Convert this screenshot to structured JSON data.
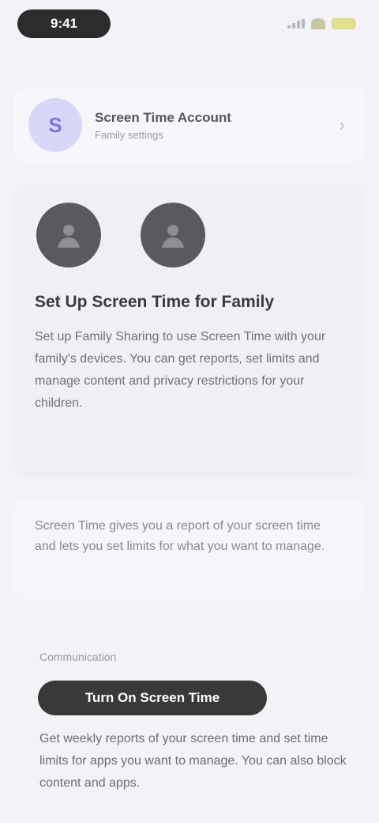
{
  "status_bar": {
    "time": "9:41",
    "signal_icon": "signal-icon",
    "wifi_icon": "wifi-icon",
    "battery_icon": "battery-icon"
  },
  "account": {
    "avatar_initials": "S",
    "name": "Screen Time Account",
    "subtitle": "Family settings",
    "chevron_icon": "chevron-right-icon"
  },
  "main_card": {
    "icon_left": "person-icon",
    "icon_right": "person-icon",
    "title": "Set Up Screen Time for Family",
    "description": "Set up Family Sharing to use Screen Time with your family's devices. You can get reports, set limits and manage content and privacy restrictions for your children."
  },
  "info_card": {
    "text": "Screen Time gives you a report of your screen time and lets you set limits for what you want to manage."
  },
  "bottom": {
    "section_label": "Communication",
    "button_label": "Turn On Screen Time",
    "aside_text": "",
    "description": "Get weekly reports of your screen time and set time limits for apps you want to manage. You can also block content and apps."
  },
  "colors": {
    "background": "#f2f2f7",
    "accent_avatar": "#d9d7f7",
    "button": "#3b3839"
  }
}
